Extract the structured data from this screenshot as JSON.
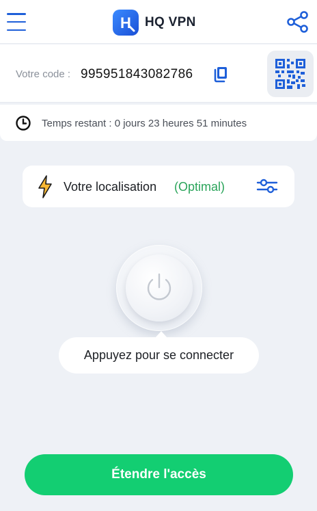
{
  "header": {
    "app_name": "HQ VPN",
    "logo_letter": "H",
    "menu_icon": "hamburger-menu-icon",
    "share_icon": "share-icon"
  },
  "code": {
    "label": "Votre code :",
    "value": "995951843082786",
    "copy_icon": "copy-icon",
    "qr_icon": "qr-code-icon"
  },
  "time": {
    "icon": "clock-icon",
    "text": "Temps restant : 0 jours 23 heures 51 minutes"
  },
  "location": {
    "icon": "lightning-bolt-icon",
    "label": "Votre localisation",
    "status": "(Optimal)",
    "settings_icon": "filter-sliders-icon"
  },
  "connect": {
    "power_icon": "power-icon",
    "hint": "Appuyez pour se connecter"
  },
  "cta": {
    "label": "Étendre l'accès"
  },
  "colors": {
    "accent_blue": "#1e5fd9",
    "green": "#13ce72",
    "status_green": "#2aa45a",
    "background": "#eef1f6"
  }
}
